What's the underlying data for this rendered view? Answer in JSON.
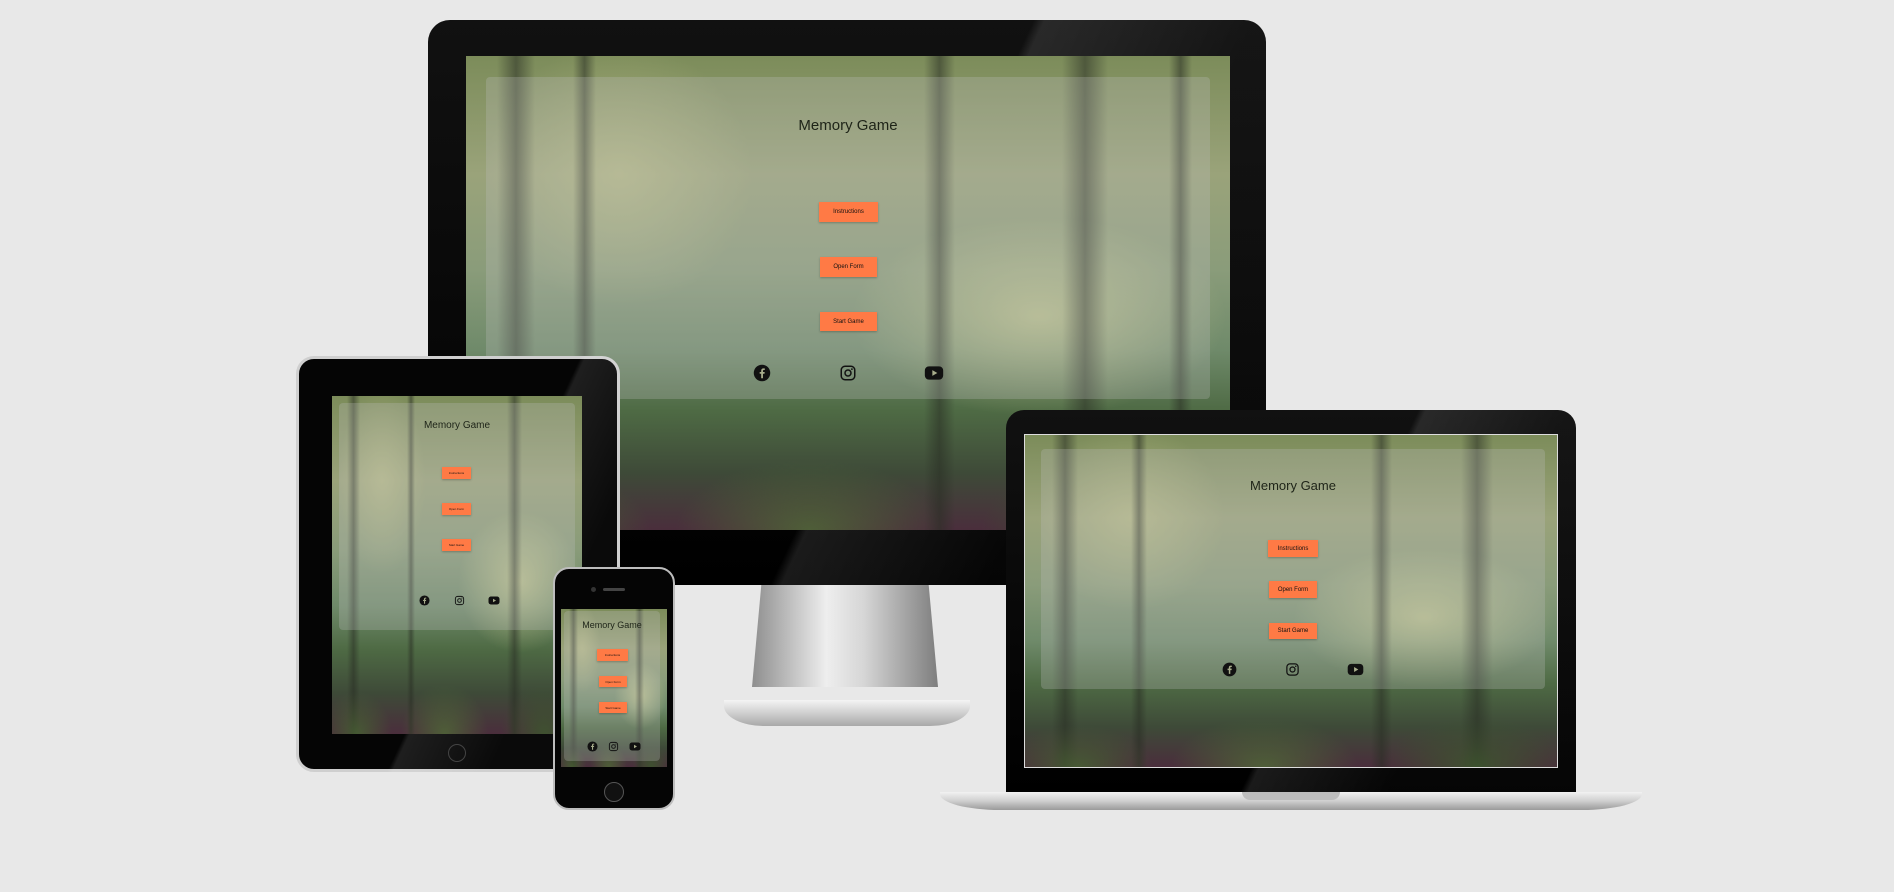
{
  "app": {
    "title": "Memory Game",
    "buttons": {
      "instructions": "Instructions",
      "open_form": "Open Form",
      "start_game": "Start Game"
    },
    "social": [
      "facebook-icon",
      "instagram-icon",
      "youtube-icon"
    ]
  },
  "colors": {
    "button": "#ff7a45",
    "page_background": "#e8e8e8",
    "panel_overlay": "rgba(190,190,190,0.28)"
  },
  "devices": [
    "desktop-monitor",
    "tablet",
    "phone",
    "laptop"
  ]
}
